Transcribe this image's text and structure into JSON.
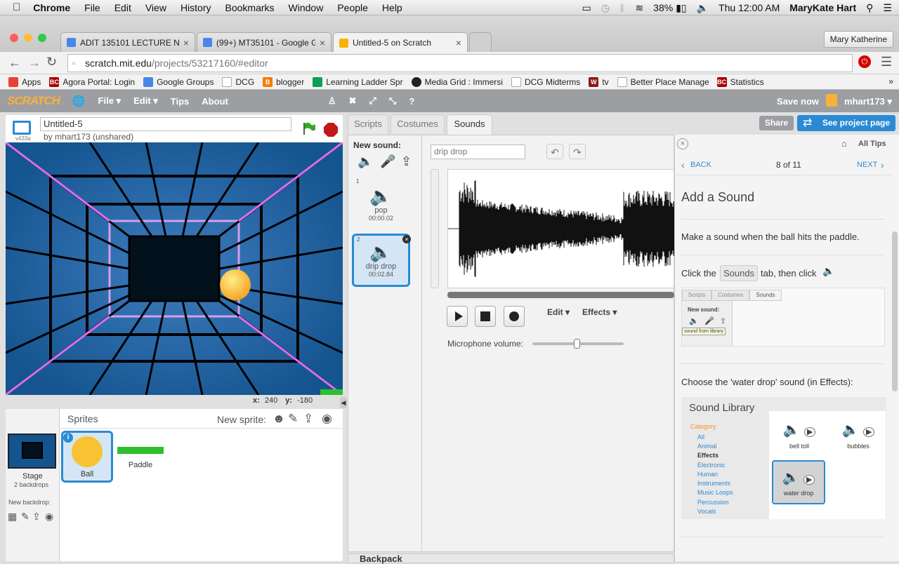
{
  "menubar": {
    "app": "Chrome",
    "items": [
      "File",
      "Edit",
      "View",
      "History",
      "Bookmarks",
      "Window",
      "People",
      "Help"
    ],
    "battery": "38%",
    "clock": "Thu 12:00 AM",
    "user": "MaryKate Hart"
  },
  "tabs": [
    {
      "title": "ADIT 135101 LECTURE NO",
      "color": "#4a86e8"
    },
    {
      "title": "(99+) MT35101 - Google G",
      "color": "#4a86e8"
    },
    {
      "title": "Untitled-5 on Scratch",
      "color": "#f4b400"
    }
  ],
  "profile_button": "Mary Katherine",
  "url": {
    "host": "scratch.mit.edu",
    "path": "/projects/53217160/#editor"
  },
  "bookmarks": [
    {
      "label": "Apps",
      "icon": "apps-icon",
      "color": "#e94235"
    },
    {
      "label": "Agora Portal: Login",
      "icon": "bc-icon",
      "color": "#a00"
    },
    {
      "label": "Google Groups",
      "icon": "google-groups-icon",
      "color": "#4a86e8"
    },
    {
      "label": "DCG",
      "icon": "page-icon",
      "color": "#ccc"
    },
    {
      "label": "blogger",
      "icon": "blogger-icon",
      "color": "#f57d00"
    },
    {
      "label": "Learning Ladder Spr",
      "icon": "sheets-icon",
      "color": "#0f9d58"
    },
    {
      "label": "Media Grid : Immersi",
      "icon": "media-grid-icon",
      "color": "#222"
    },
    {
      "label": "DCG Midterms",
      "icon": "page-icon",
      "color": "#ccc"
    },
    {
      "label": "tv",
      "icon": "tv-icon",
      "color": "#8b1a1a"
    },
    {
      "label": "Better Place Manage",
      "icon": "page-icon",
      "color": "#ccc"
    },
    {
      "label": "Statistics",
      "icon": "bc-icon",
      "color": "#a00"
    }
  ],
  "scratch_header": {
    "logo": "SCRATCH",
    "menu": [
      "File ▾",
      "Edit ▾",
      "Tips",
      "About"
    ],
    "save": "Save now",
    "user": "mhart173 ▾"
  },
  "project": {
    "title": "Untitled-5",
    "byline": "by mhart173 (unshared)",
    "version": "v433a"
  },
  "stage_coords": {
    "x_label": "x:",
    "x": "240",
    "y_label": "y:",
    "y": "-180"
  },
  "sprites_pane": {
    "title": "Sprites",
    "new_sprite": "New sprite:",
    "stage_label": "Stage",
    "backdrops": "2 backdrops",
    "new_backdrop": "New backdrop:",
    "sprites": [
      "Ball",
      "Paddle"
    ]
  },
  "editor_tabs": [
    "Scripts",
    "Costumes",
    "Sounds"
  ],
  "share_button": "Share",
  "see_project_button": "See project page",
  "sounds": {
    "new_sound": "New sound:",
    "list": [
      {
        "index": "1",
        "name": "pop",
        "duration": "00:00.02"
      },
      {
        "index": "2",
        "name": "drip drop",
        "duration": "00:02.84"
      }
    ],
    "current_name": "drip drop",
    "edit_menu": "Edit ▾",
    "effects_menu": "Effects ▾",
    "mic_label": "Microphone volume:"
  },
  "backpack": "Backpack",
  "tips": {
    "all_tips": "All Tips",
    "back": "BACK",
    "next": "NEXT",
    "page": "8 of 11",
    "title": "Add a Sound",
    "step1": "Make a sound when the ball hits the paddle.",
    "step2_a": "Click the",
    "step2_tab": "Sounds",
    "step2_b": "tab, then click",
    "mini_tabs": [
      "Scripts",
      "Costumes",
      "Sounds"
    ],
    "mini_new_sound": "New sound:",
    "mini_tooltip": "sound from library",
    "step3": "Choose the 'water drop' sound (in Effects):",
    "library": {
      "title": "Sound Library",
      "category_label": "Category",
      "categories": [
        "All",
        "Animal",
        "Effects",
        "Electronic",
        "Human",
        "Instruments",
        "Music Loops",
        "Percussion",
        "Vocals"
      ],
      "sounds": [
        "bell toll",
        "bubbles",
        "water drop"
      ]
    }
  }
}
